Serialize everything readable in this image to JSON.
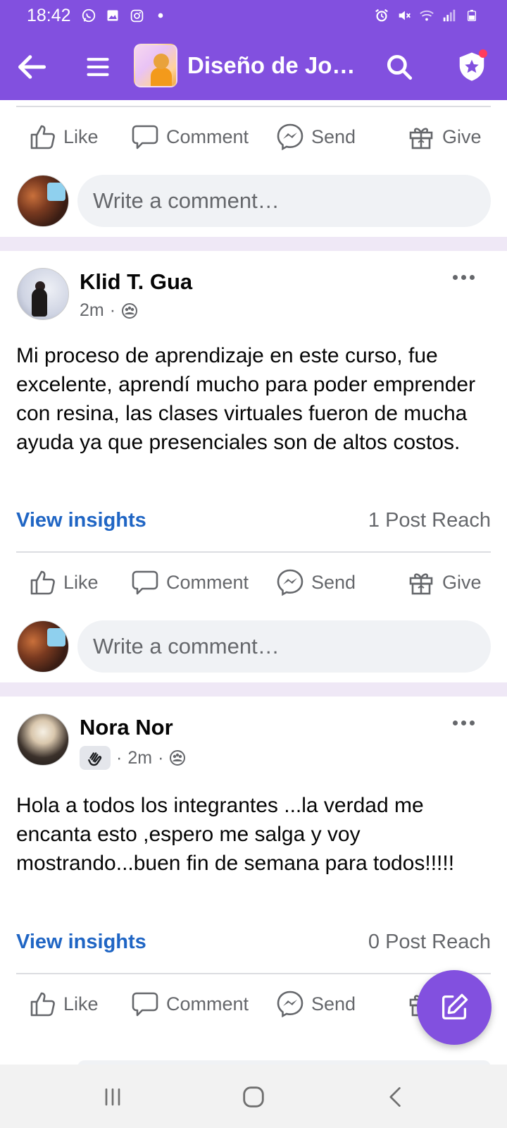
{
  "status_bar": {
    "time": "18:42"
  },
  "app_bar": {
    "group_title": "Diseño de Joyería en Resina",
    "icons": [
      "back-arrow-icon",
      "menu-icon",
      "search-icon",
      "admin-shield-icon"
    ],
    "accent_color": "#8250df"
  },
  "actions": {
    "like": "Like",
    "comment": "Comment",
    "send": "Send",
    "give": "Give"
  },
  "comment_box": {
    "placeholder": "Write a comment…"
  },
  "posts": [
    {
      "author": "Klid T. Gua",
      "time": "2m",
      "separator": "·",
      "text": "Mi proceso de aprendizaje en este curso, fue excelente, aprendí mucho para poder emprender con resina, las clases virtuales fueron de mucha ayuda ya que presenciales son de altos costos.",
      "insights_label": "View insights",
      "reach": "1 Post Reach"
    },
    {
      "author": "Nora Nor",
      "time": "2m",
      "separator": "·",
      "text": "Hola a todos los integrantes ...la verdad me encanta esto ,espero me salga y voy mostrando...buen fin de semana para todos!!!!!",
      "insights_label": "View insights",
      "reach": "0 Post Reach"
    }
  ],
  "link_color": "#1f65c4"
}
